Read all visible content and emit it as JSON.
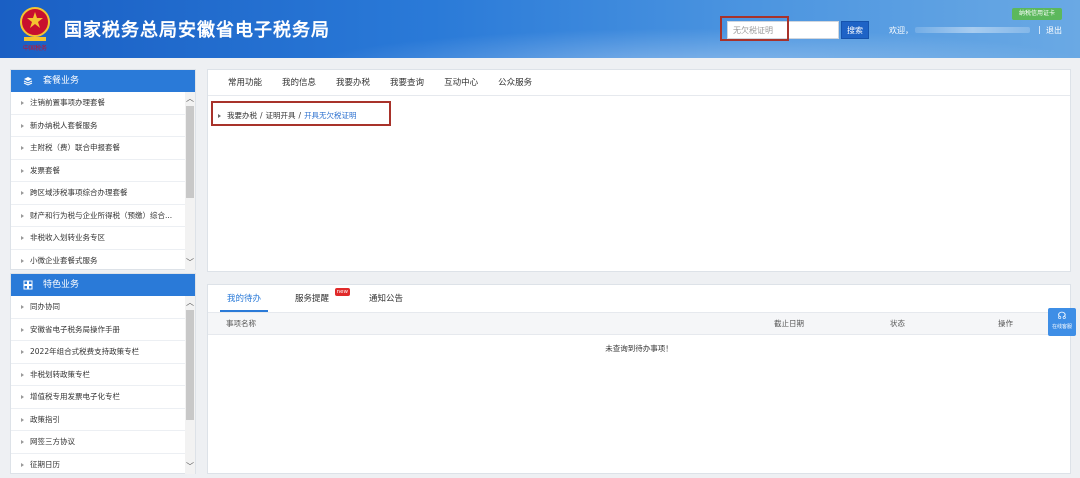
{
  "header": {
    "title": "国家税务总局安徽省电子税务局",
    "emblem_caption": "中国税务",
    "search_placeholder": "无欠税证明",
    "search_button": "搜索",
    "welcome": "欢迎，",
    "separator": "|",
    "logout": "退出",
    "credit_badge": "纳税信用证卡"
  },
  "sidebar": {
    "package": {
      "title": "套餐业务",
      "items": [
        "注销前置事项办理套餐",
        "新办纳税人套餐服务",
        "主附税（费）联合申报套餐",
        "发票套餐",
        "跨区域涉税事项综合办理套餐",
        "财产和行为税与企业所得税（预缴）综合...",
        "非税收入划转业务专区",
        "小微企业套餐式服务"
      ]
    },
    "feature": {
      "title": "特色业务",
      "items": [
        "同办协同",
        "安徽省电子税务局操作手册",
        "2022年组合式税费支持政策专栏",
        "非税划转政策专栏",
        "增值税专用发票电子化专栏",
        "政策指引",
        "网签三方协议",
        "征期日历"
      ]
    },
    "scroll_up": "︿",
    "scroll_down": "﹀"
  },
  "topnav": {
    "items": [
      "常用功能",
      "我的信息",
      "我要办税",
      "我要查询",
      "互动中心",
      "公众服务"
    ]
  },
  "breadcrumb": {
    "part1": "我要办税",
    "sep1": "/",
    "part2": "证明开具",
    "sep2": "/",
    "part3": "开具无欠税证明"
  },
  "tasks": {
    "tabs": [
      "我的待办",
      "服务提醒",
      "通知公告"
    ],
    "new_badge": "new",
    "columns": [
      "事项名称",
      "截止日期",
      "状态",
      "操作"
    ],
    "empty_message": "未查询到待办事项！"
  },
  "help": {
    "label": "在线客服"
  },
  "colors": {
    "brand_blue": "#2a7ad8",
    "highlight_red": "#a8322a",
    "new_red": "#e02a2a",
    "badge_green": "#5cb85c"
  }
}
